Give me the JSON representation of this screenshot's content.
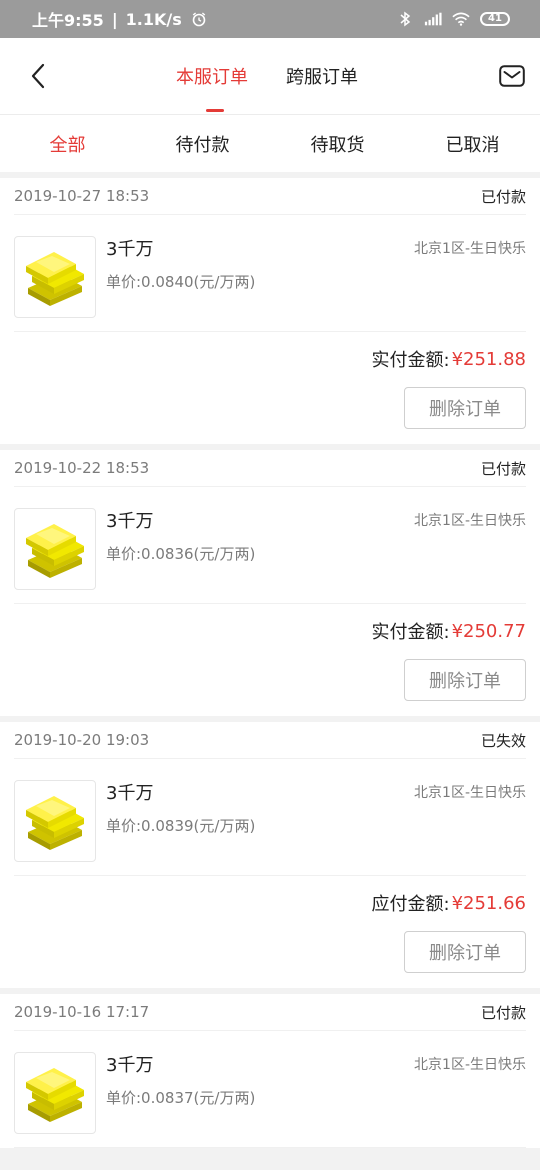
{
  "status_bar": {
    "time": "上午9:55",
    "speed": "1.1K/s",
    "battery": "41"
  },
  "header": {
    "tabs": [
      {
        "label": "本服订单"
      },
      {
        "label": "跨服订单"
      }
    ]
  },
  "filters": [
    "全部",
    "待付款",
    "待取货",
    "已取消"
  ],
  "orders": [
    {
      "time": "2019-10-27 18:53",
      "status": "已付款",
      "title": "3千万",
      "server": "北京1区-生日快乐",
      "unit_price": "单价:0.0840(元/万两)",
      "amount_label": "实付金额:",
      "amount": "¥251.88",
      "button": "删除订单"
    },
    {
      "time": "2019-10-22 18:53",
      "status": "已付款",
      "title": "3千万",
      "server": "北京1区-生日快乐",
      "unit_price": "单价:0.0836(元/万两)",
      "amount_label": "实付金额:",
      "amount": "¥250.77",
      "button": "删除订单"
    },
    {
      "time": "2019-10-20 19:03",
      "status": "已失效",
      "title": "3千万",
      "server": "北京1区-生日快乐",
      "unit_price": "单价:0.0839(元/万两)",
      "amount_label": "应付金额:",
      "amount": "¥251.66",
      "button": "删除订单"
    },
    {
      "time": "2019-10-16 17:17",
      "status": "已付款",
      "title": "3千万",
      "server": "北京1区-生日快乐",
      "unit_price": "单价:0.0837(元/万两)"
    }
  ],
  "colors": {
    "accent": "#e43b37",
    "status_bar": "#9b9b9b",
    "background": "#f2f2f2"
  }
}
